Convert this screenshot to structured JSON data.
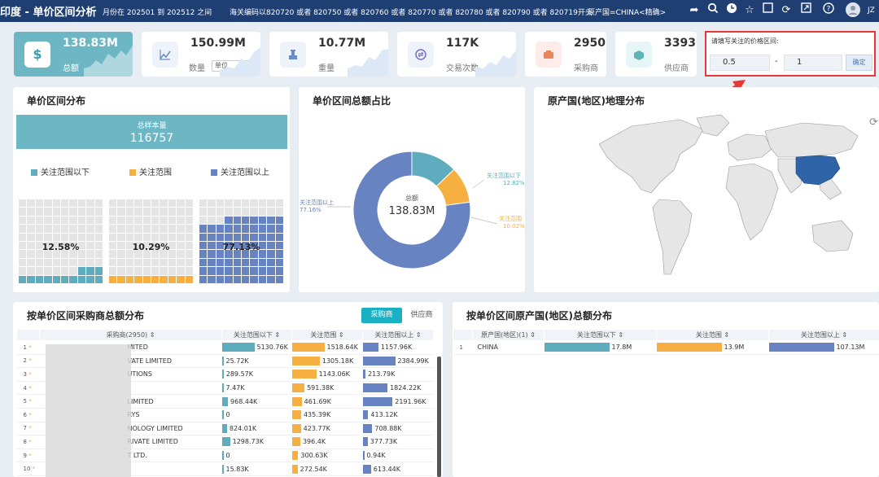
{
  "header": {
    "title": "印度 - 单价区间分析",
    "filter_month": "月份在 202501 到 202512 之间",
    "filter_hs": "海关编码以820720 或者 820750 或者 820760 或者 820770 或者 820780 或者 820790 或者 820719开头",
    "filter_origin": "原产国=CHINA<精确>",
    "user": "JZ",
    "icons": [
      "share-icon",
      "search-icon",
      "clock-icon",
      "star-icon",
      "copy-icon",
      "refresh-icon",
      "fullscreen-icon",
      "help-icon",
      "avatar-icon"
    ]
  },
  "kpis": [
    {
      "value": "138.83M",
      "label": "总额",
      "icon": "dollar-icon"
    },
    {
      "value": "150.99M",
      "label": "数量",
      "icon": "line-chart-icon",
      "unit": "单位"
    },
    {
      "value": "10.77M",
      "label": "重量",
      "icon": "scale-icon"
    },
    {
      "value": "117K",
      "label": "交易次数",
      "icon": "exchange-icon"
    },
    {
      "value": "2950",
      "label": "采购商",
      "icon": "buyer-icon"
    },
    {
      "value": "3393",
      "label": "供应商",
      "icon": "supplier-icon"
    }
  ],
  "price": {
    "label": "请填写关注的价格区间:",
    "from": "0.5",
    "dash": "-",
    "to": "1",
    "ok": "确定"
  },
  "dist": {
    "title": "单价区间分布",
    "total_label": "总样本量",
    "total_value": "116757",
    "legend": [
      "关注范围以下",
      "关注范围",
      "关注范围以上"
    ],
    "pcts": [
      "12.58%",
      "10.29%",
      "77.13%"
    ],
    "fill": [
      12.58,
      10.29,
      77.13
    ]
  },
  "donut": {
    "title": "单价区间总额占比",
    "center_label": "总额",
    "center_value": "138.83M",
    "labels": [
      {
        "name": "关注范围以下",
        "pct": "12.82%"
      },
      {
        "name": "关注范围",
        "pct": "10.02%"
      },
      {
        "name": "关注范围以上",
        "pct": "77.16%"
      }
    ],
    "values": [
      12.82,
      10.02,
      77.16
    ]
  },
  "geo": {
    "title": "原产国(地区)地理分布"
  },
  "buyers": {
    "title": "按单价区间采购商总额分布",
    "tabs": [
      "采购商",
      "供应商"
    ],
    "headers": [
      "采购商(2950)",
      "关注范围以下",
      "关注范围",
      "关注范围以上"
    ],
    "rows": [
      {
        "idx": "1",
        "name": "MITED",
        "below": "5130.76K",
        "range": "1518.64K",
        "above": "1157.96K"
      },
      {
        "idx": "2",
        "name": "VATE LIMITED",
        "below": "25.72K",
        "range": "1305.18K",
        "above": "2384.99K"
      },
      {
        "idx": "3",
        "name": "UTIONS",
        "below": "289.57K",
        "range": "1143.06K",
        "above": "213.79K"
      },
      {
        "idx": "4",
        "name": "",
        "below": "7.47K",
        "range": "591.38K",
        "above": "1824.22K"
      },
      {
        "idx": "5",
        "name": "LIMITED",
        "below": "968.44K",
        "range": "461.69K",
        "above": "2191.96K"
      },
      {
        "idx": "6",
        "name": "RYS",
        "below": "0",
        "range": "435.39K",
        "above": "413.12K"
      },
      {
        "idx": "7",
        "name": "NOLOGY LIMITED",
        "below": "824.01K",
        "range": "423.77K",
        "above": "708.88K"
      },
      {
        "idx": "8",
        "name": "RIVATE LIMITED",
        "below": "1298.73K",
        "range": "396.4K",
        "above": "377.73K"
      },
      {
        "idx": "9",
        "name": "T LTD.",
        "below": "0",
        "range": "300.63K",
        "above": "0.94K"
      },
      {
        "idx": "10",
        "name": "",
        "below": "15.83K",
        "range": "272.54K",
        "above": "613.44K"
      }
    ]
  },
  "origins": {
    "title": "按单价区间原产国(地区)总额分布",
    "headers": [
      "原产国(地区)(1)",
      "关注范围以下",
      "关注范围",
      "关注范围以上"
    ],
    "rows": [
      {
        "idx": "1",
        "name": "CHINA",
        "below": "17.8M",
        "range": "13.9M",
        "above": "107.13M"
      }
    ]
  },
  "colors": {
    "teal": "#5eacbd",
    "orange": "#f5b041",
    "blue": "#6783c2",
    "active": "#6db7c5",
    "header": "#1f3f73"
  }
}
